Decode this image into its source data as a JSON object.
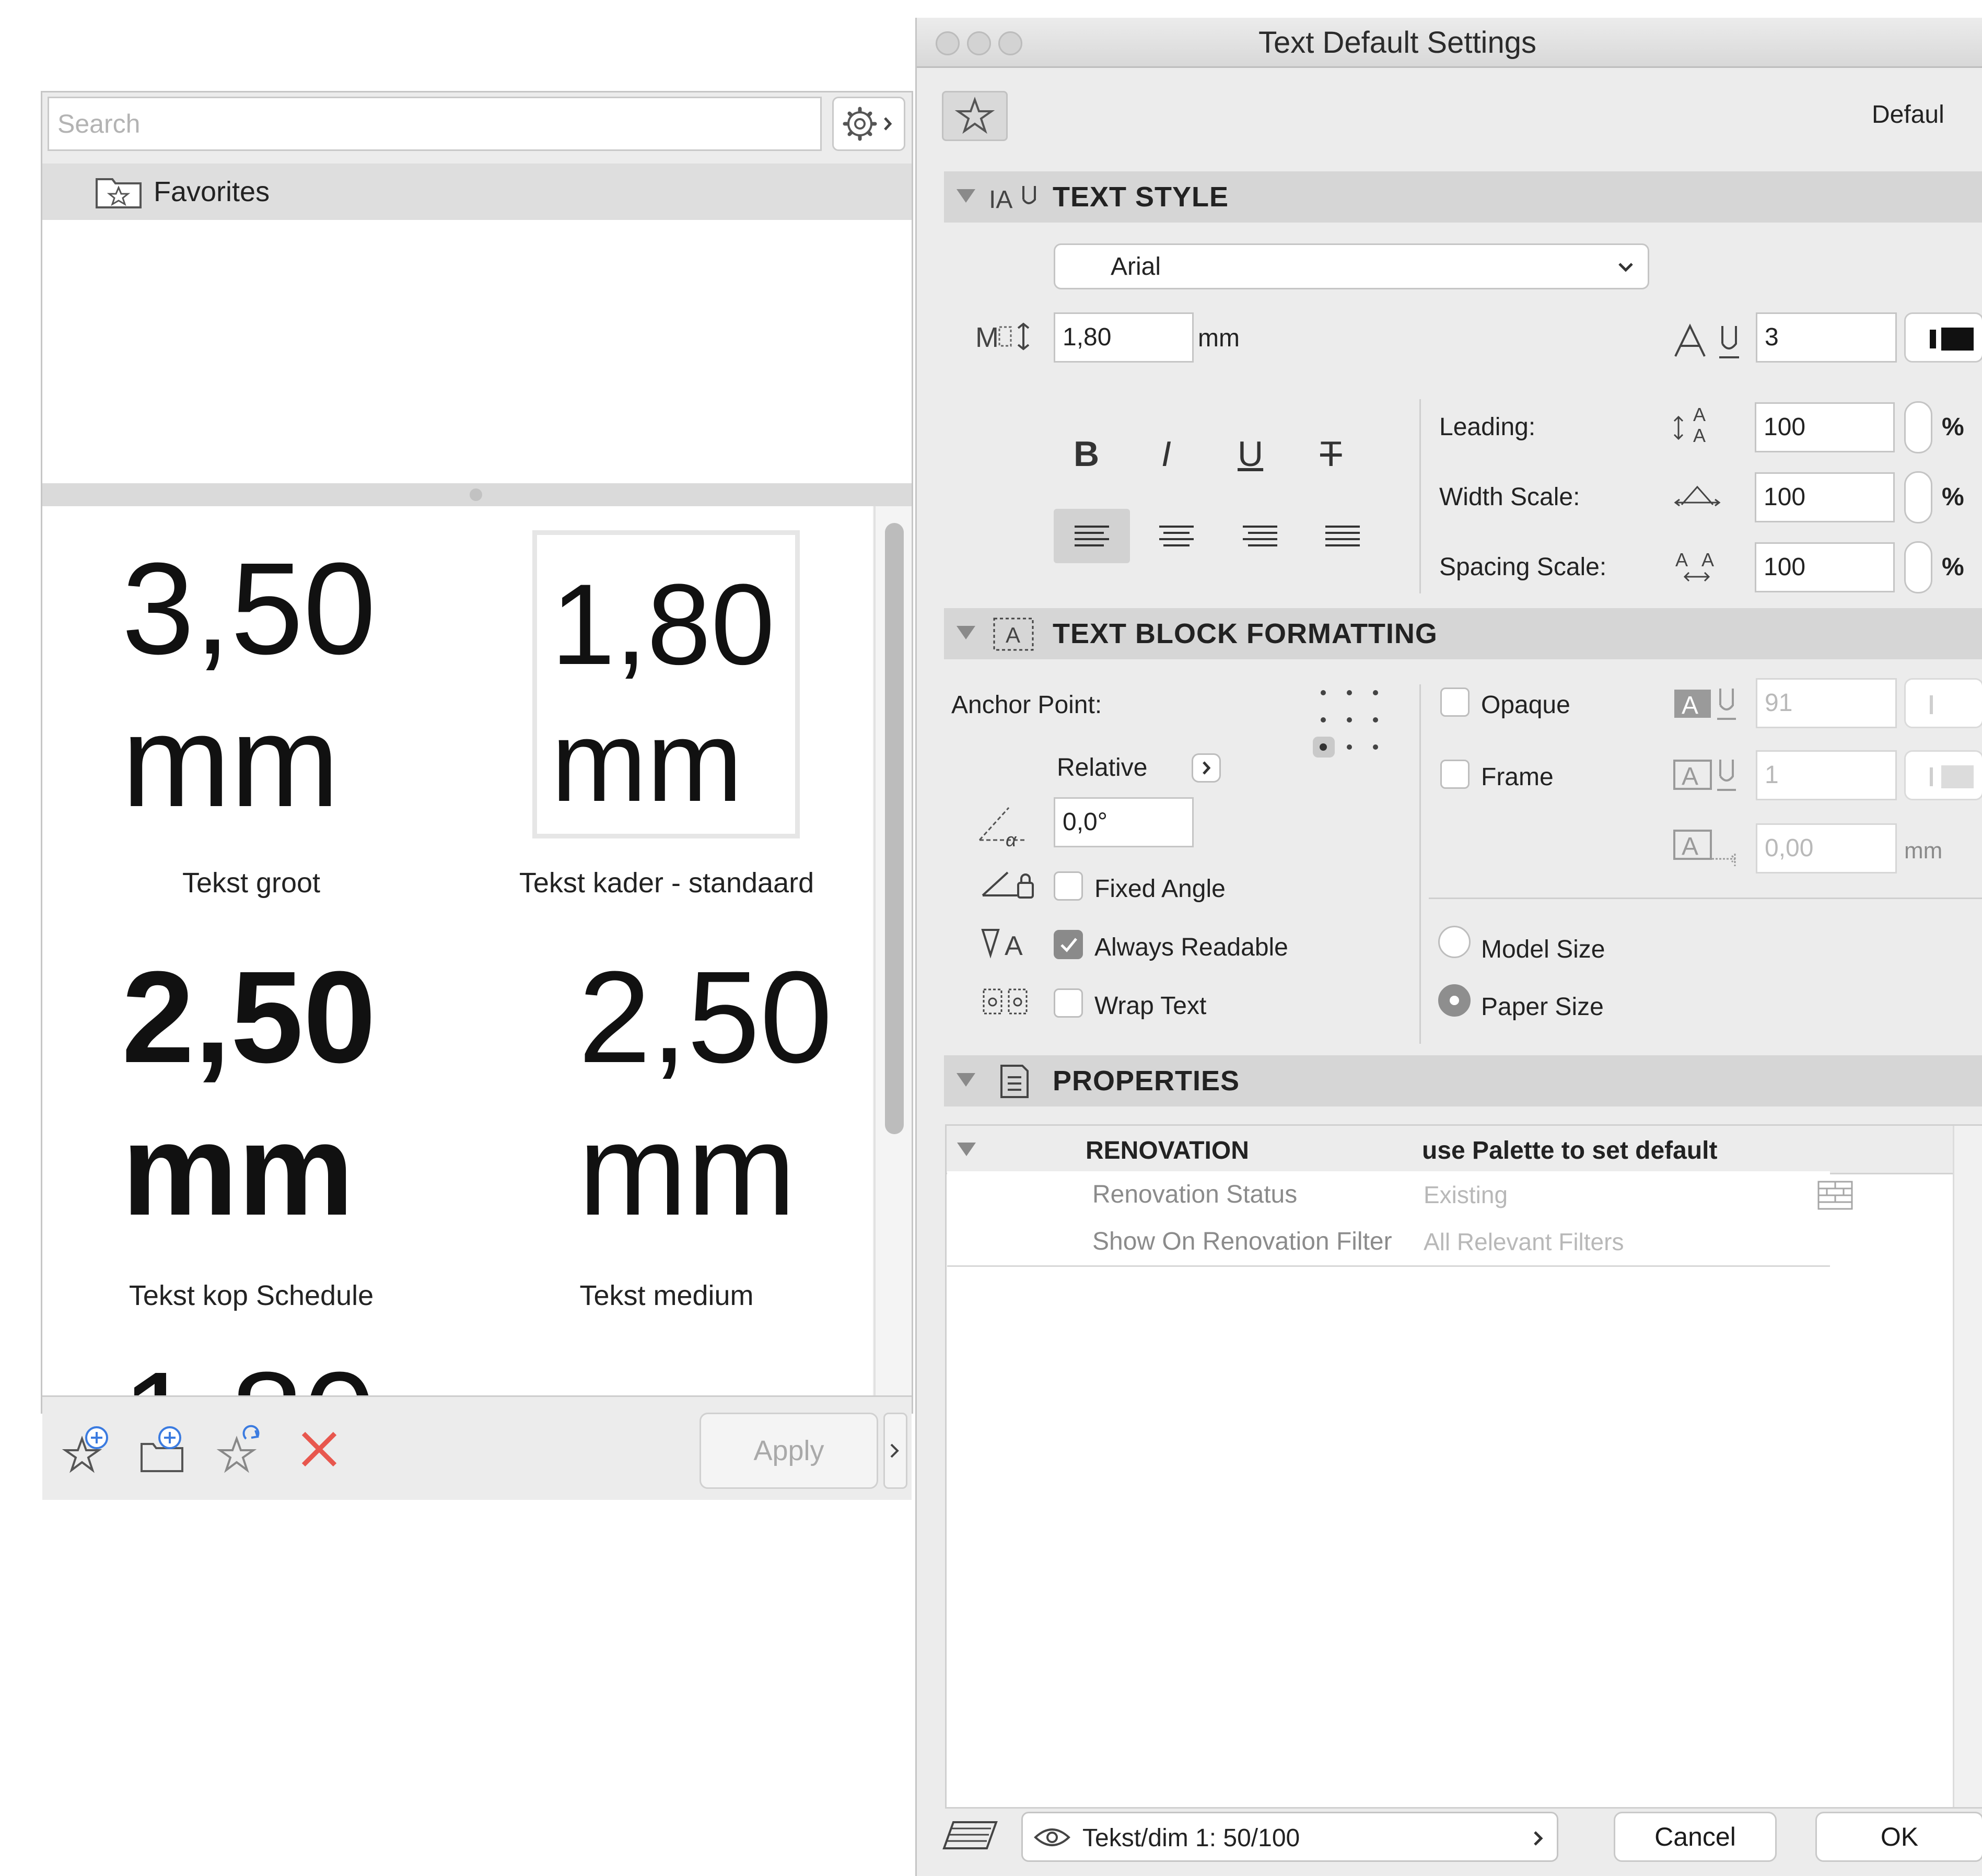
{
  "favorites": {
    "search_placeholder": "Search",
    "folder_label": "Favorites",
    "items": [
      {
        "value": "3,50",
        "unit": "mm",
        "caption": "Tekst groot",
        "bold": false,
        "selected": false
      },
      {
        "value": "1,80",
        "unit": "mm",
        "caption": "Tekst kader - standaard",
        "bold": false,
        "selected": true
      },
      {
        "value": "2,50",
        "unit": "mm",
        "caption": "Tekst kop Schedule",
        "bold": true,
        "selected": false
      },
      {
        "value": "2,50",
        "unit": "mm",
        "caption": "Tekst medium",
        "bold": false,
        "selected": false
      }
    ],
    "apply_label": "Apply"
  },
  "dialog": {
    "title": "Text Default Settings",
    "default_label": "Defaul",
    "text_style": {
      "header": "TEXT STYLE",
      "font": "Arial",
      "size_value": "1,80",
      "size_unit": "mm",
      "pen_value": "3",
      "leading_label": "Leading:",
      "leading_value": "100",
      "width_label": "Width Scale:",
      "width_value": "100",
      "spacing_label": "Spacing Scale:",
      "spacing_value": "100",
      "percent": "%",
      "bold_glyph": "B",
      "italic_glyph": "I",
      "underline_glyph": "U",
      "strike_glyph": "T"
    },
    "block": {
      "header": "TEXT BLOCK FORMATTING",
      "anchor_label": "Anchor Point:",
      "relative_label": "Relative",
      "angle_value": "0,0°",
      "fixed_angle_label": "Fixed Angle",
      "always_readable_label": "Always Readable",
      "always_readable_checked": true,
      "wrap_text_label": "Wrap Text",
      "opaque_label": "Opaque",
      "frame_label": "Frame",
      "opaque_pen": "91",
      "frame_pen": "1",
      "offset_value": "0,00",
      "offset_unit": "mm",
      "model_size_label": "Model Size",
      "paper_size_label": "Paper Size",
      "selected_size": "Paper Size"
    },
    "properties": {
      "header": "PROPERTIES",
      "group_name": "RENOVATION",
      "group_value": "use Palette to set default",
      "rows": [
        {
          "name": "Renovation Status",
          "value": "Existing"
        },
        {
          "name": "Show On Renovation Filter",
          "value": "All Relevant Filters"
        }
      ]
    },
    "footer": {
      "layer_label": "Tekst/dim 1: 50/100",
      "cancel_label": "Cancel",
      "ok_label": "OK"
    }
  }
}
